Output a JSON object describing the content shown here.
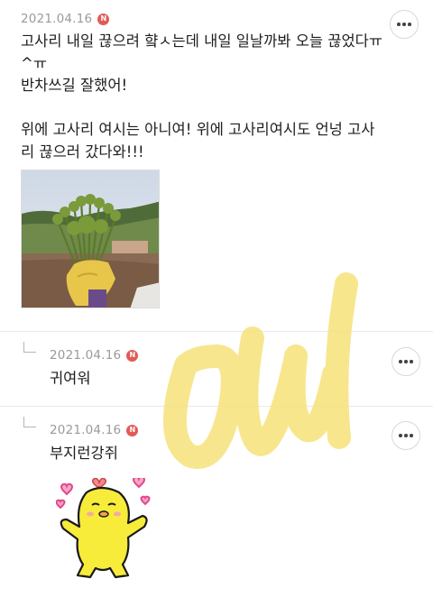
{
  "post": {
    "date": "2021.04.16",
    "badge": "N",
    "body": "고사리 내일 끊으려 햨ㅅ는데 내일 일날까봐 오늘 끊었다ㅠ\n^ㅠ\n반차쓰길 잘했어!\n\n위에 고사리 여시는 아니여! 위에 고사리여시도 언넝 고사\n리 끊으러 갔다와!!!",
    "photo_alt": "hand-holding-fern-bundle-photo"
  },
  "comments": [
    {
      "date": "2021.04.16",
      "badge": "N",
      "text": "귀여워"
    },
    {
      "date": "2021.04.16",
      "badge": "N",
      "text": "부지런강쥐"
    }
  ],
  "colors": {
    "badge": "#e25b57",
    "date": "#9a9a9a",
    "watermark": "#f7e27a",
    "sticker_body": "#f8ec3a",
    "heart": "#e0488a"
  }
}
